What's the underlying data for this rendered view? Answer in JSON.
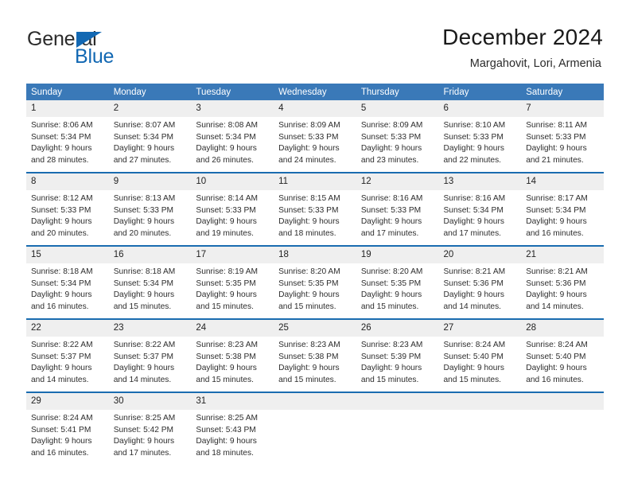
{
  "brand": {
    "name_top": "General",
    "name_bottom": "Blue",
    "accent_color": "#1268b3"
  },
  "header": {
    "title": "December 2024",
    "subtitle": "Margahovit, Lori, Armenia"
  },
  "theme": {
    "header_bg": "#3a79b8",
    "separator": "#1a6cb0",
    "daynum_bg": "#efefef",
    "text": "#2d2d2d"
  },
  "weekday_headers": [
    "Sunday",
    "Monday",
    "Tuesday",
    "Wednesday",
    "Thursday",
    "Friday",
    "Saturday"
  ],
  "labels": {
    "sunrise": "Sunrise:",
    "sunset": "Sunset:",
    "daylight": "Daylight:"
  },
  "weeks": [
    [
      {
        "day": "1",
        "sunrise": "Sunrise: 8:06 AM",
        "sunset": "Sunset: 5:34 PM",
        "daylight_1": "Daylight: 9 hours",
        "daylight_2": "and 28 minutes."
      },
      {
        "day": "2",
        "sunrise": "Sunrise: 8:07 AM",
        "sunset": "Sunset: 5:34 PM",
        "daylight_1": "Daylight: 9 hours",
        "daylight_2": "and 27 minutes."
      },
      {
        "day": "3",
        "sunrise": "Sunrise: 8:08 AM",
        "sunset": "Sunset: 5:34 PM",
        "daylight_1": "Daylight: 9 hours",
        "daylight_2": "and 26 minutes."
      },
      {
        "day": "4",
        "sunrise": "Sunrise: 8:09 AM",
        "sunset": "Sunset: 5:33 PM",
        "daylight_1": "Daylight: 9 hours",
        "daylight_2": "and 24 minutes."
      },
      {
        "day": "5",
        "sunrise": "Sunrise: 8:09 AM",
        "sunset": "Sunset: 5:33 PM",
        "daylight_1": "Daylight: 9 hours",
        "daylight_2": "and 23 minutes."
      },
      {
        "day": "6",
        "sunrise": "Sunrise: 8:10 AM",
        "sunset": "Sunset: 5:33 PM",
        "daylight_1": "Daylight: 9 hours",
        "daylight_2": "and 22 minutes."
      },
      {
        "day": "7",
        "sunrise": "Sunrise: 8:11 AM",
        "sunset": "Sunset: 5:33 PM",
        "daylight_1": "Daylight: 9 hours",
        "daylight_2": "and 21 minutes."
      }
    ],
    [
      {
        "day": "8",
        "sunrise": "Sunrise: 8:12 AM",
        "sunset": "Sunset: 5:33 PM",
        "daylight_1": "Daylight: 9 hours",
        "daylight_2": "and 20 minutes."
      },
      {
        "day": "9",
        "sunrise": "Sunrise: 8:13 AM",
        "sunset": "Sunset: 5:33 PM",
        "daylight_1": "Daylight: 9 hours",
        "daylight_2": "and 20 minutes."
      },
      {
        "day": "10",
        "sunrise": "Sunrise: 8:14 AM",
        "sunset": "Sunset: 5:33 PM",
        "daylight_1": "Daylight: 9 hours",
        "daylight_2": "and 19 minutes."
      },
      {
        "day": "11",
        "sunrise": "Sunrise: 8:15 AM",
        "sunset": "Sunset: 5:33 PM",
        "daylight_1": "Daylight: 9 hours",
        "daylight_2": "and 18 minutes."
      },
      {
        "day": "12",
        "sunrise": "Sunrise: 8:16 AM",
        "sunset": "Sunset: 5:33 PM",
        "daylight_1": "Daylight: 9 hours",
        "daylight_2": "and 17 minutes."
      },
      {
        "day": "13",
        "sunrise": "Sunrise: 8:16 AM",
        "sunset": "Sunset: 5:34 PM",
        "daylight_1": "Daylight: 9 hours",
        "daylight_2": "and 17 minutes."
      },
      {
        "day": "14",
        "sunrise": "Sunrise: 8:17 AM",
        "sunset": "Sunset: 5:34 PM",
        "daylight_1": "Daylight: 9 hours",
        "daylight_2": "and 16 minutes."
      }
    ],
    [
      {
        "day": "15",
        "sunrise": "Sunrise: 8:18 AM",
        "sunset": "Sunset: 5:34 PM",
        "daylight_1": "Daylight: 9 hours",
        "daylight_2": "and 16 minutes."
      },
      {
        "day": "16",
        "sunrise": "Sunrise: 8:18 AM",
        "sunset": "Sunset: 5:34 PM",
        "daylight_1": "Daylight: 9 hours",
        "daylight_2": "and 15 minutes."
      },
      {
        "day": "17",
        "sunrise": "Sunrise: 8:19 AM",
        "sunset": "Sunset: 5:35 PM",
        "daylight_1": "Daylight: 9 hours",
        "daylight_2": "and 15 minutes."
      },
      {
        "day": "18",
        "sunrise": "Sunrise: 8:20 AM",
        "sunset": "Sunset: 5:35 PM",
        "daylight_1": "Daylight: 9 hours",
        "daylight_2": "and 15 minutes."
      },
      {
        "day": "19",
        "sunrise": "Sunrise: 8:20 AM",
        "sunset": "Sunset: 5:35 PM",
        "daylight_1": "Daylight: 9 hours",
        "daylight_2": "and 15 minutes."
      },
      {
        "day": "20",
        "sunrise": "Sunrise: 8:21 AM",
        "sunset": "Sunset: 5:36 PM",
        "daylight_1": "Daylight: 9 hours",
        "daylight_2": "and 14 minutes."
      },
      {
        "day": "21",
        "sunrise": "Sunrise: 8:21 AM",
        "sunset": "Sunset: 5:36 PM",
        "daylight_1": "Daylight: 9 hours",
        "daylight_2": "and 14 minutes."
      }
    ],
    [
      {
        "day": "22",
        "sunrise": "Sunrise: 8:22 AM",
        "sunset": "Sunset: 5:37 PM",
        "daylight_1": "Daylight: 9 hours",
        "daylight_2": "and 14 minutes."
      },
      {
        "day": "23",
        "sunrise": "Sunrise: 8:22 AM",
        "sunset": "Sunset: 5:37 PM",
        "daylight_1": "Daylight: 9 hours",
        "daylight_2": "and 14 minutes."
      },
      {
        "day": "24",
        "sunrise": "Sunrise: 8:23 AM",
        "sunset": "Sunset: 5:38 PM",
        "daylight_1": "Daylight: 9 hours",
        "daylight_2": "and 15 minutes."
      },
      {
        "day": "25",
        "sunrise": "Sunrise: 8:23 AM",
        "sunset": "Sunset: 5:38 PM",
        "daylight_1": "Daylight: 9 hours",
        "daylight_2": "and 15 minutes."
      },
      {
        "day": "26",
        "sunrise": "Sunrise: 8:23 AM",
        "sunset": "Sunset: 5:39 PM",
        "daylight_1": "Daylight: 9 hours",
        "daylight_2": "and 15 minutes."
      },
      {
        "day": "27",
        "sunrise": "Sunrise: 8:24 AM",
        "sunset": "Sunset: 5:40 PM",
        "daylight_1": "Daylight: 9 hours",
        "daylight_2": "and 15 minutes."
      },
      {
        "day": "28",
        "sunrise": "Sunrise: 8:24 AM",
        "sunset": "Sunset: 5:40 PM",
        "daylight_1": "Daylight: 9 hours",
        "daylight_2": "and 16 minutes."
      }
    ],
    [
      {
        "day": "29",
        "sunrise": "Sunrise: 8:24 AM",
        "sunset": "Sunset: 5:41 PM",
        "daylight_1": "Daylight: 9 hours",
        "daylight_2": "and 16 minutes."
      },
      {
        "day": "30",
        "sunrise": "Sunrise: 8:25 AM",
        "sunset": "Sunset: 5:42 PM",
        "daylight_1": "Daylight: 9 hours",
        "daylight_2": "and 17 minutes."
      },
      {
        "day": "31",
        "sunrise": "Sunrise: 8:25 AM",
        "sunset": "Sunset: 5:43 PM",
        "daylight_1": "Daylight: 9 hours",
        "daylight_2": "and 18 minutes."
      },
      {
        "day": "",
        "sunrise": "",
        "sunset": "",
        "daylight_1": "",
        "daylight_2": ""
      },
      {
        "day": "",
        "sunrise": "",
        "sunset": "",
        "daylight_1": "",
        "daylight_2": ""
      },
      {
        "day": "",
        "sunrise": "",
        "sunset": "",
        "daylight_1": "",
        "daylight_2": ""
      },
      {
        "day": "",
        "sunrise": "",
        "sunset": "",
        "daylight_1": "",
        "daylight_2": ""
      }
    ]
  ]
}
